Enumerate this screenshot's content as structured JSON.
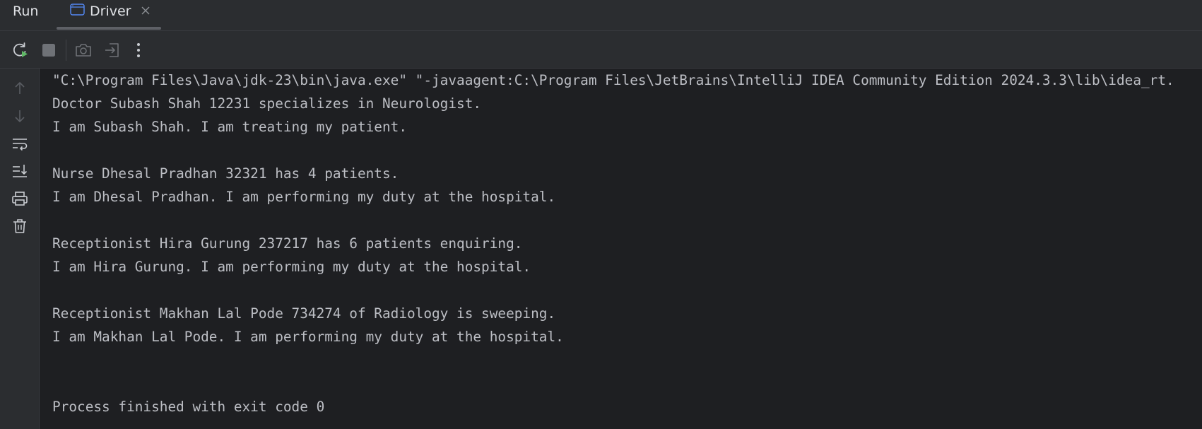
{
  "header": {
    "title": "Run",
    "tab": {
      "label": "Driver"
    }
  },
  "console": {
    "lines": [
      "\"C:\\Program Files\\Java\\jdk-23\\bin\\java.exe\" \"-javaagent:C:\\Program Files\\JetBrains\\IntelliJ IDEA Community Edition 2024.3.3\\lib\\idea_rt.",
      "Doctor Subash Shah 12231 specializes in Neurologist.",
      "I am Subash Shah. I am treating my patient.",
      "",
      "Nurse Dhesal Pradhan 32321 has 4 patients.",
      "I am Dhesal Pradhan. I am performing my duty at the hospital.",
      "",
      "Receptionist Hira Gurung 237217 has 6 patients enquiring.",
      "I am Hira Gurung. I am performing my duty at the hospital.",
      "",
      "Receptionist Makhan Lal Pode 734274 of Radiology is sweeping.",
      "I am Makhan Lal Pode. I am performing my duty at the hospital.",
      "",
      "",
      "Process finished with exit code 0"
    ]
  },
  "toolbar": {
    "icons": [
      "rerun-icon",
      "stop-icon",
      "camera-icon",
      "exit-icon",
      "more-vertical-icon"
    ]
  },
  "gutter": {
    "icons": [
      "arrow-up-icon",
      "arrow-down-icon",
      "soft-wrap-icon",
      "scroll-to-end-icon",
      "print-icon",
      "trash-icon"
    ]
  },
  "colors": {
    "background": "#1e1f22",
    "panel": "#2b2d30",
    "text": "#bcbec4",
    "rerun_accent": "#5fb865"
  }
}
